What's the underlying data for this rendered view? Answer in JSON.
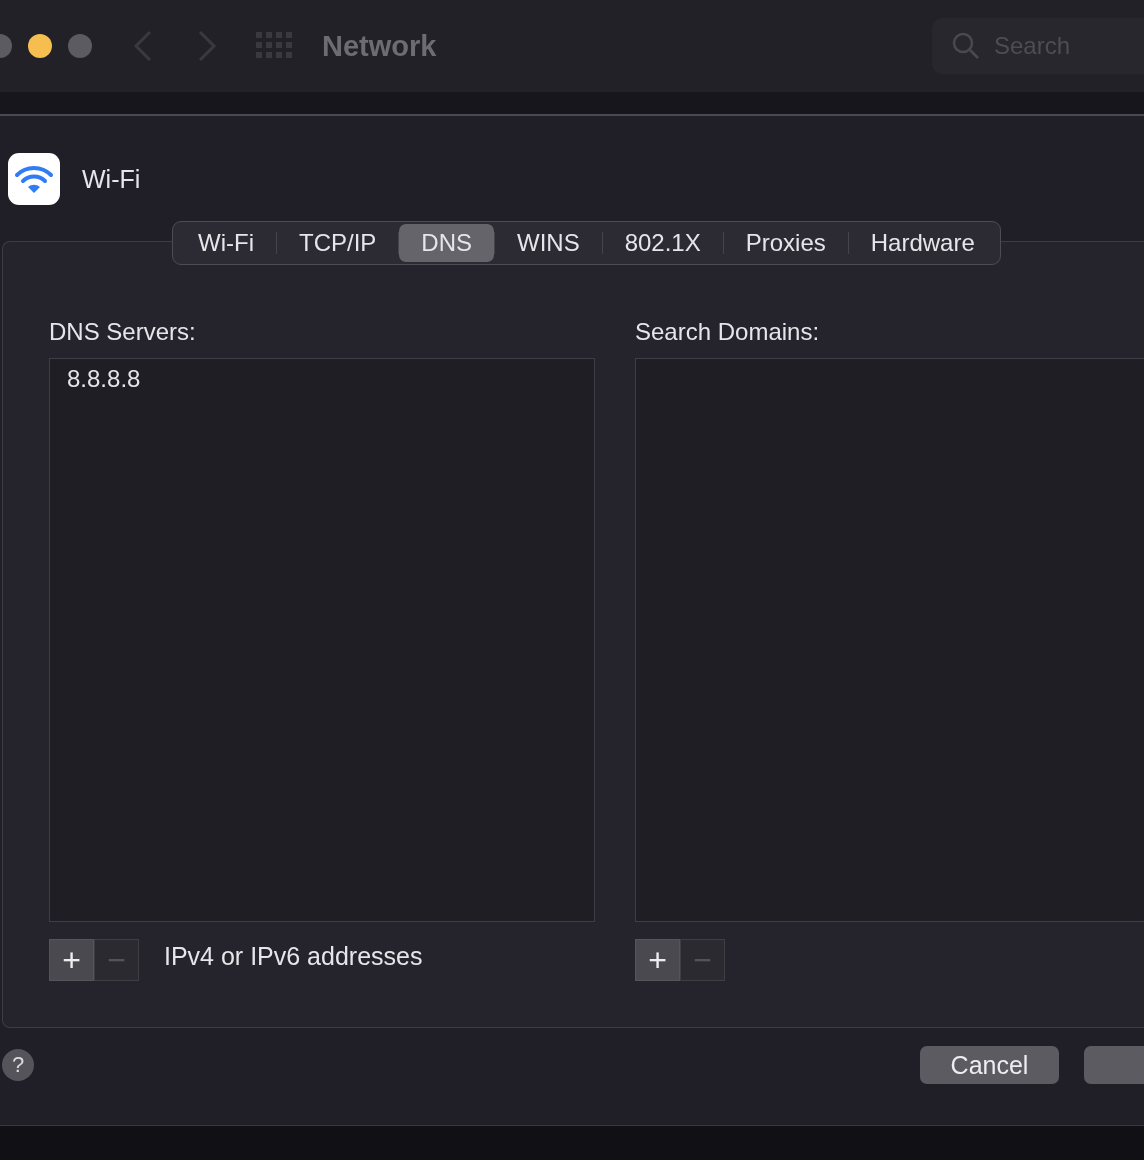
{
  "window": {
    "title": "Network",
    "search": {
      "placeholder": "Search"
    }
  },
  "service": {
    "name": "Wi-Fi"
  },
  "tabs": [
    {
      "label": "Wi-Fi",
      "selected": false
    },
    {
      "label": "TCP/IP",
      "selected": false
    },
    {
      "label": "DNS",
      "selected": true
    },
    {
      "label": "WINS",
      "selected": false
    },
    {
      "label": "802.1X",
      "selected": false
    },
    {
      "label": "Proxies",
      "selected": false
    },
    {
      "label": "Hardware",
      "selected": false
    }
  ],
  "dns_servers": {
    "label": "DNS Servers:",
    "entries": [
      "8.8.8.8"
    ],
    "hint": "IPv4 or IPv6 addresses",
    "controls": [
      {
        "symbol": "+",
        "disabled": false
      },
      {
        "symbol": "−",
        "disabled": true
      }
    ]
  },
  "search_domains": {
    "label": "Search Domains:",
    "controls": [
      {
        "symbol": "+",
        "disabled": false
      },
      {
        "symbol": "−",
        "disabled": true
      }
    ]
  },
  "help": {
    "symbol": "?"
  },
  "buttons": [
    {
      "kind": "text",
      "label": "Cancel"
    },
    {
      "kind": "cut"
    }
  ]
}
